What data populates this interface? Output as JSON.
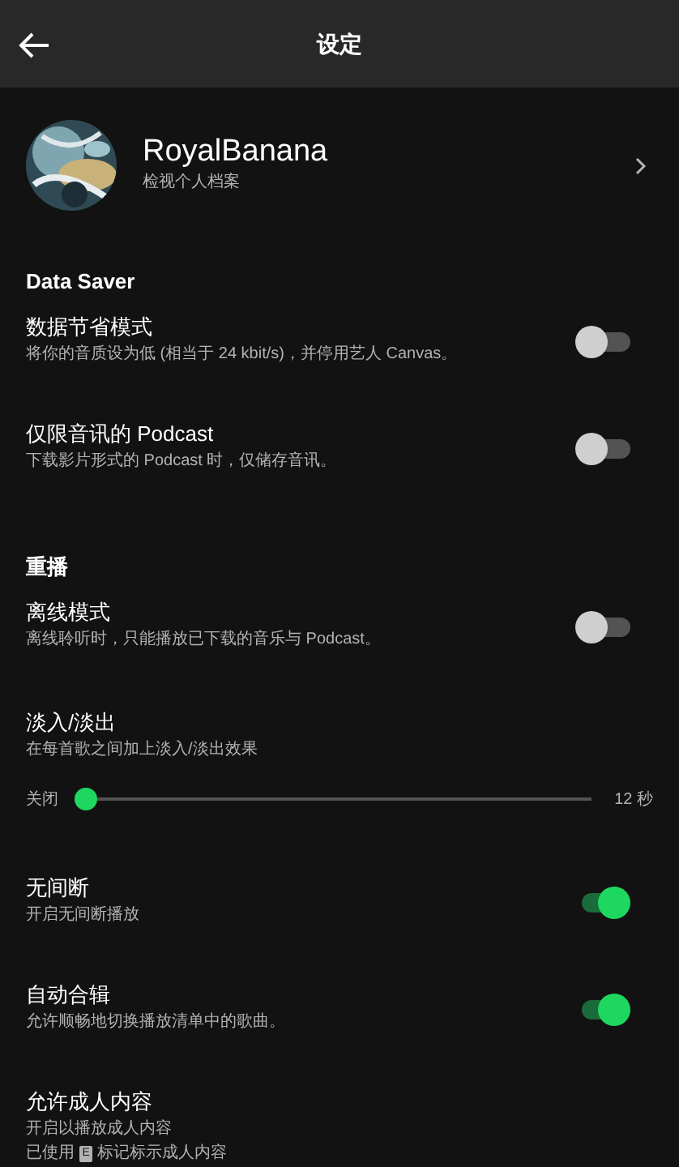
{
  "header": {
    "title": "设定"
  },
  "profile": {
    "name": "RoyalBanana",
    "subtitle": "检视个人档案"
  },
  "sections": [
    {
      "title": "Data Saver",
      "items": [
        {
          "kind": "toggle",
          "title": "数据节省模式",
          "subtitle": "将你的音质设为低 (相当于 24 kbit/s)，并停用艺人 Canvas。",
          "on": false
        },
        {
          "kind": "toggle",
          "title": "仅限音讯的 Podcast",
          "subtitle": "下载影片形式的 Podcast 时，仅储存音讯。",
          "on": false
        }
      ]
    },
    {
      "title": "重播",
      "items": [
        {
          "kind": "toggle",
          "title": "离线模式",
          "subtitle": "离线聆听时，只能播放已下载的音乐与 Podcast。",
          "on": false
        },
        {
          "kind": "slider",
          "title": "淡入/淡出",
          "subtitle": "在每首歌之间加上淡入/淡出效果",
          "min_label": "关闭",
          "max_label": "12 秒",
          "level": 0
        },
        {
          "kind": "toggle",
          "title": "无间断",
          "subtitle": "开启无间断播放",
          "on": true
        },
        {
          "kind": "toggle",
          "title": "自动合辑",
          "subtitle": "允许顺畅地切换播放清单中的歌曲。",
          "on": true
        },
        {
          "kind": "explicit",
          "title": "允许成人内容",
          "subtitle": "开启以播放成人内容",
          "note_before": "已使用",
          "badge": "E",
          "note_after": "标记标示成人内容"
        }
      ]
    }
  ]
}
